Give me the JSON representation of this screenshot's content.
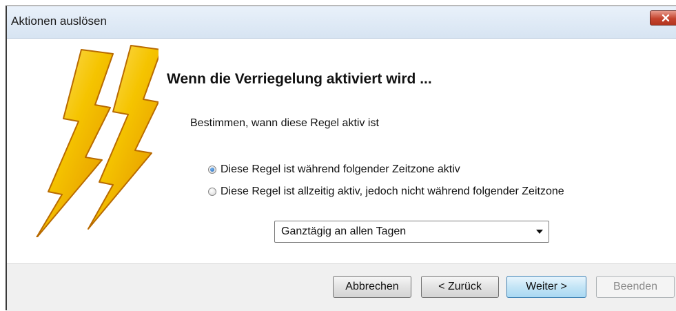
{
  "window": {
    "title": "Aktionen auslösen",
    "close_icon": "close-icon"
  },
  "wizard": {
    "heading": "Wenn die Verriegelung aktiviert wird ...",
    "subtitle": "Bestimmen, wann diese Regel aktiv ist",
    "illustration": "lightning-bolts-icon",
    "options": [
      {
        "label": "Diese Regel ist während folgender Zeitzone aktiv",
        "checked": true
      },
      {
        "label": "Diese Regel ist allzeitig aktiv, jedoch nicht während folgender Zeitzone",
        "checked": false
      }
    ],
    "timezone_select": {
      "value": "Ganztägig an allen Tagen"
    }
  },
  "buttons": {
    "cancel": "Abbrechen",
    "back": "< Zurück",
    "next": "Weiter >",
    "finish": "Beenden"
  },
  "colors": {
    "bolt_yellow": "#f5c400",
    "bolt_orange": "#e08a00",
    "primary_button": "#c4e5f6",
    "close_button": "#c5442e"
  }
}
